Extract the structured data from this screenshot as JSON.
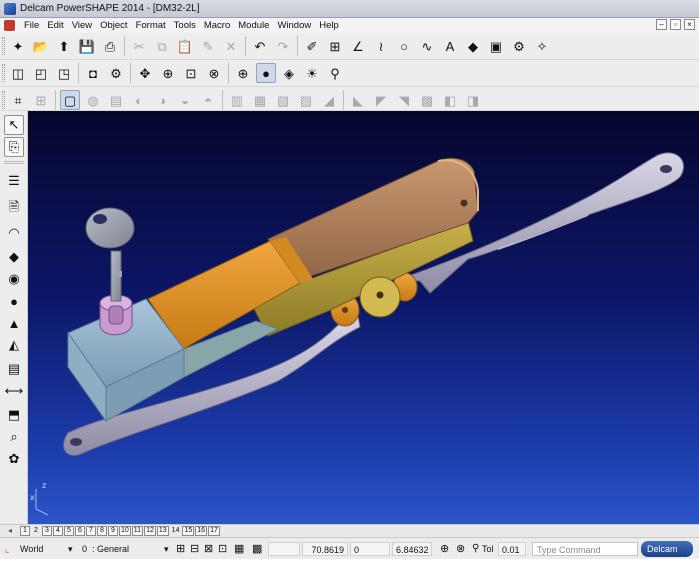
{
  "window": {
    "title": "Delcam PowerSHAPE 2014 - [DM32-2L]"
  },
  "menu": {
    "items": [
      "File",
      "Edit",
      "View",
      "Object",
      "Format",
      "Tools",
      "Macro",
      "Module",
      "Window",
      "Help"
    ],
    "controls": [
      "–",
      "▫",
      "×"
    ]
  },
  "toolbars": {
    "row1": [
      {
        "icon": "new-file-icon",
        "glyph": "✦"
      },
      {
        "icon": "open-folder-icon",
        "glyph": "📂"
      },
      {
        "icon": "import-icon",
        "glyph": "⬆"
      },
      {
        "icon": "save-icon",
        "glyph": "💾"
      },
      {
        "icon": "print-icon",
        "glyph": "⎙"
      },
      {
        "icon": "cut-icon",
        "glyph": "✂"
      },
      {
        "icon": "copy-icon",
        "glyph": "⧉"
      },
      {
        "icon": "paste-icon",
        "glyph": "📋"
      },
      {
        "icon": "edit-icon",
        "glyph": "✎"
      },
      {
        "icon": "delete-icon",
        "glyph": "✕"
      },
      {
        "icon": "undo-icon",
        "glyph": "↶"
      },
      {
        "icon": "redo-icon",
        "glyph": "↷"
      },
      {
        "icon": "sketch-icon",
        "glyph": "✐"
      },
      {
        "icon": "workplane-icon",
        "glyph": "⊞"
      },
      {
        "icon": "line-icon",
        "glyph": "∠"
      },
      {
        "icon": "polyline-icon",
        "glyph": "≀"
      },
      {
        "icon": "circle-icon",
        "glyph": "○"
      },
      {
        "icon": "curve-icon",
        "glyph": "∿"
      },
      {
        "icon": "text-icon",
        "glyph": "A"
      },
      {
        "icon": "surface-icon",
        "glyph": "◆"
      },
      {
        "icon": "solid-icon",
        "glyph": "▣"
      },
      {
        "icon": "assembly-icon",
        "glyph": "⚙"
      },
      {
        "icon": "wizard-icon",
        "glyph": "✧"
      }
    ],
    "row2": [
      {
        "icon": "view-iso-icon",
        "glyph": "◫"
      },
      {
        "icon": "view-front-icon",
        "glyph": "◰"
      },
      {
        "icon": "view-top-icon",
        "glyph": "◳"
      },
      {
        "icon": "view-cube-icon",
        "glyph": "◘"
      },
      {
        "icon": "view-options-icon",
        "glyph": "⚙"
      },
      {
        "icon": "pan-icon",
        "glyph": "✥"
      },
      {
        "icon": "zoom-icon",
        "glyph": "⊕"
      },
      {
        "icon": "zoom-box-icon",
        "glyph": "⊡"
      },
      {
        "icon": "zoom-fit-icon",
        "glyph": "⊗"
      },
      {
        "icon": "wireframe-icon",
        "glyph": "⊕"
      },
      {
        "icon": "shaded-icon",
        "glyph": "●"
      },
      {
        "icon": "shaded-edges-icon",
        "glyph": "◈"
      },
      {
        "icon": "light-icon",
        "glyph": "☀"
      },
      {
        "icon": "probe-icon",
        "glyph": "⚲"
      }
    ],
    "row3": [
      {
        "icon": "feature-select-icon",
        "glyph": "⌗"
      },
      {
        "icon": "feature-add-icon",
        "glyph": "⊞"
      },
      {
        "icon": "solid-box-icon",
        "glyph": "▢"
      },
      {
        "icon": "solid-cylinder-icon",
        "glyph": "◍"
      },
      {
        "icon": "solid-extrude-icon",
        "glyph": "▤"
      },
      {
        "icon": "solid-revolve-icon",
        "glyph": "◐"
      },
      {
        "icon": "solid-sweep-icon",
        "glyph": "◑"
      },
      {
        "icon": "solid-blend-icon",
        "glyph": "◒"
      },
      {
        "icon": "solid-shell-icon",
        "glyph": "◓"
      },
      {
        "icon": "boolean-add-icon",
        "glyph": "▥"
      },
      {
        "icon": "boolean-subtract-icon",
        "glyph": "▦"
      },
      {
        "icon": "boolean-intersect-icon",
        "glyph": "▧"
      },
      {
        "icon": "solid-split-icon",
        "glyph": "▨"
      },
      {
        "icon": "fillet-icon",
        "glyph": "◢"
      },
      {
        "icon": "chamfer-icon",
        "glyph": "◣"
      },
      {
        "icon": "draft-icon",
        "glyph": "◤"
      },
      {
        "icon": "hole-icon",
        "glyph": "◥"
      },
      {
        "icon": "pattern-icon",
        "glyph": "▩"
      },
      {
        "icon": "mirror-icon",
        "glyph": "◧"
      },
      {
        "icon": "move-icon",
        "glyph": "◨"
      }
    ]
  },
  "left_toolbar": [
    {
      "icon": "select-arrow-icon",
      "glyph": "↖"
    },
    {
      "icon": "selection-info-icon",
      "glyph": "⎘"
    },
    {
      "icon": "level-icon",
      "glyph": "☰"
    },
    {
      "icon": "document-icon",
      "glyph": "🗎"
    },
    {
      "icon": "arc-icon",
      "glyph": "◠"
    },
    {
      "icon": "surface-tool-icon",
      "glyph": "◆"
    },
    {
      "icon": "sphere-icon",
      "glyph": "◉"
    },
    {
      "icon": "shaded-sphere-icon",
      "glyph": "●"
    },
    {
      "icon": "analysis-icon",
      "glyph": "▲"
    },
    {
      "icon": "measure-icon",
      "glyph": "◭"
    },
    {
      "icon": "layer-icon",
      "glyph": "▤"
    },
    {
      "icon": "dimension-icon",
      "glyph": "⟷"
    },
    {
      "icon": "section-icon",
      "glyph": "⬒"
    },
    {
      "icon": "probe-tool-icon",
      "glyph": "⌕"
    },
    {
      "icon": "render-icon",
      "glyph": "✿"
    }
  ],
  "viewport": {
    "axis_x": "x",
    "axis_z": "z"
  },
  "tabs": [
    "1",
    "2",
    "3",
    "4",
    "5",
    "6",
    "7",
    "8",
    "9",
    "10",
    "11",
    "12",
    "13",
    "14",
    "15",
    "16",
    "17"
  ],
  "tabs_plain": [
    "2",
    "14"
  ],
  "status": {
    "workplane": "World",
    "level_number": "0",
    "level_name": "General",
    "x_value": "70.8619",
    "y_value": "0",
    "z_value": "6.84632",
    "tol_label": "Tol",
    "tol_value": "0.01",
    "command_placeholder": "Type Command",
    "logo_text": "Delcam"
  }
}
